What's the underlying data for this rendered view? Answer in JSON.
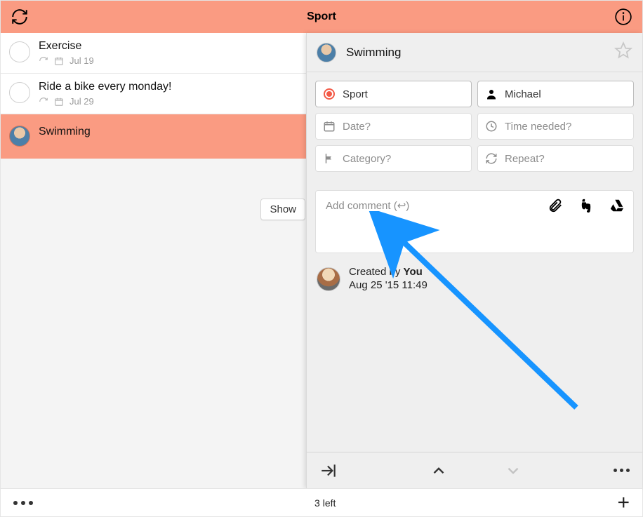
{
  "header": {
    "title": "Sport"
  },
  "tasks": [
    {
      "title": "Exercise",
      "date": "Jul 19"
    },
    {
      "title": "Ride a bike every monday!",
      "date": "Jul 29"
    },
    {
      "title": "Swimming"
    }
  ],
  "show_button_label": "Show",
  "detail": {
    "title": "Swimming",
    "list_label": "Sport",
    "assignee": "Michael",
    "date_placeholder": "Date?",
    "time_placeholder": "Time needed?",
    "category_placeholder": "Category?",
    "repeat_placeholder": "Repeat?",
    "comment_placeholder": "Add comment (↩)",
    "created_by_prefix": "Created by ",
    "created_by_name": "You",
    "created_at": "Aug 25 '15 11:49"
  },
  "footer": {
    "status": "3 left"
  }
}
